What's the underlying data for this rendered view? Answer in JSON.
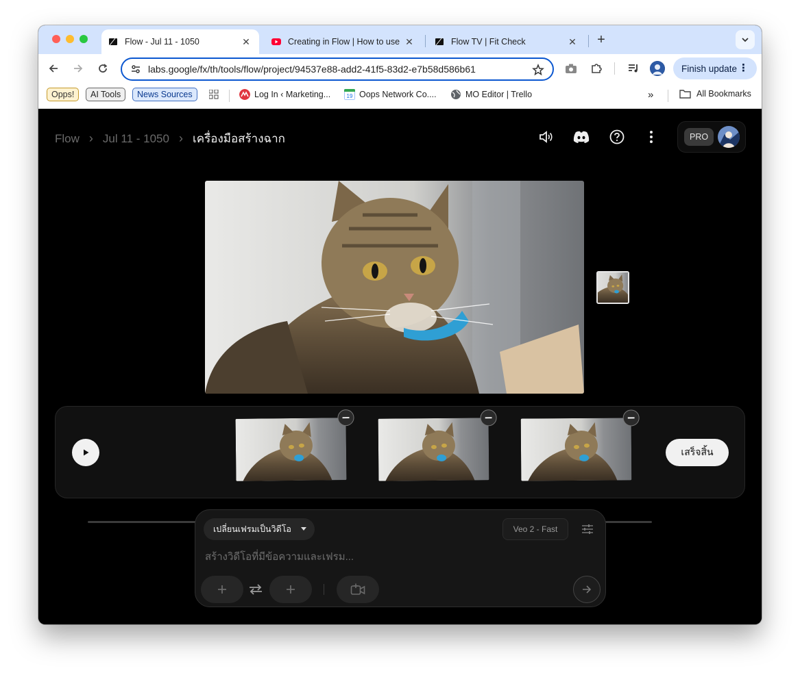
{
  "browser": {
    "tabs": [
      {
        "title": "Flow - Jul 11 - 1050",
        "active": true
      },
      {
        "title": "Creating in Flow | How to use",
        "active": false
      },
      {
        "title": "Flow TV | Fit Check",
        "active": false
      }
    ],
    "url": "labs.google/fx/th/tools/flow/project/94537e88-add2-41f5-83d2-e7b58d586b61",
    "finish_update_label": "Finish update",
    "bookmarks": {
      "chips": [
        "Opps!",
        "AI Tools",
        "News Sources"
      ],
      "links": [
        "Log In ‹ Marketing...",
        "Oops Network Co....",
        "MO Editor | Trello"
      ],
      "overflow": "»",
      "all_bookmarks": "All Bookmarks"
    },
    "accent": "#0b57d0"
  },
  "app": {
    "breadcrumb": [
      "Flow",
      "Jul 11 - 1050",
      "เครื่องมือสร้างฉาก"
    ],
    "breadcrumb_separator": "›",
    "header_icons": [
      "volume-icon",
      "discord-icon",
      "help-icon",
      "more-vert-icon"
    ],
    "plan_badge": "PRO",
    "timeline": {
      "clip_count": 3,
      "done_label": "เสร็จสิ้น"
    },
    "composer": {
      "mode": "เปลี่ยนเฟรมเป็นวิดีโอ",
      "model": "Veo 2 - Fast",
      "placeholder": "สร้างวิดีโอที่มีข้อความและเฟรม..."
    }
  }
}
